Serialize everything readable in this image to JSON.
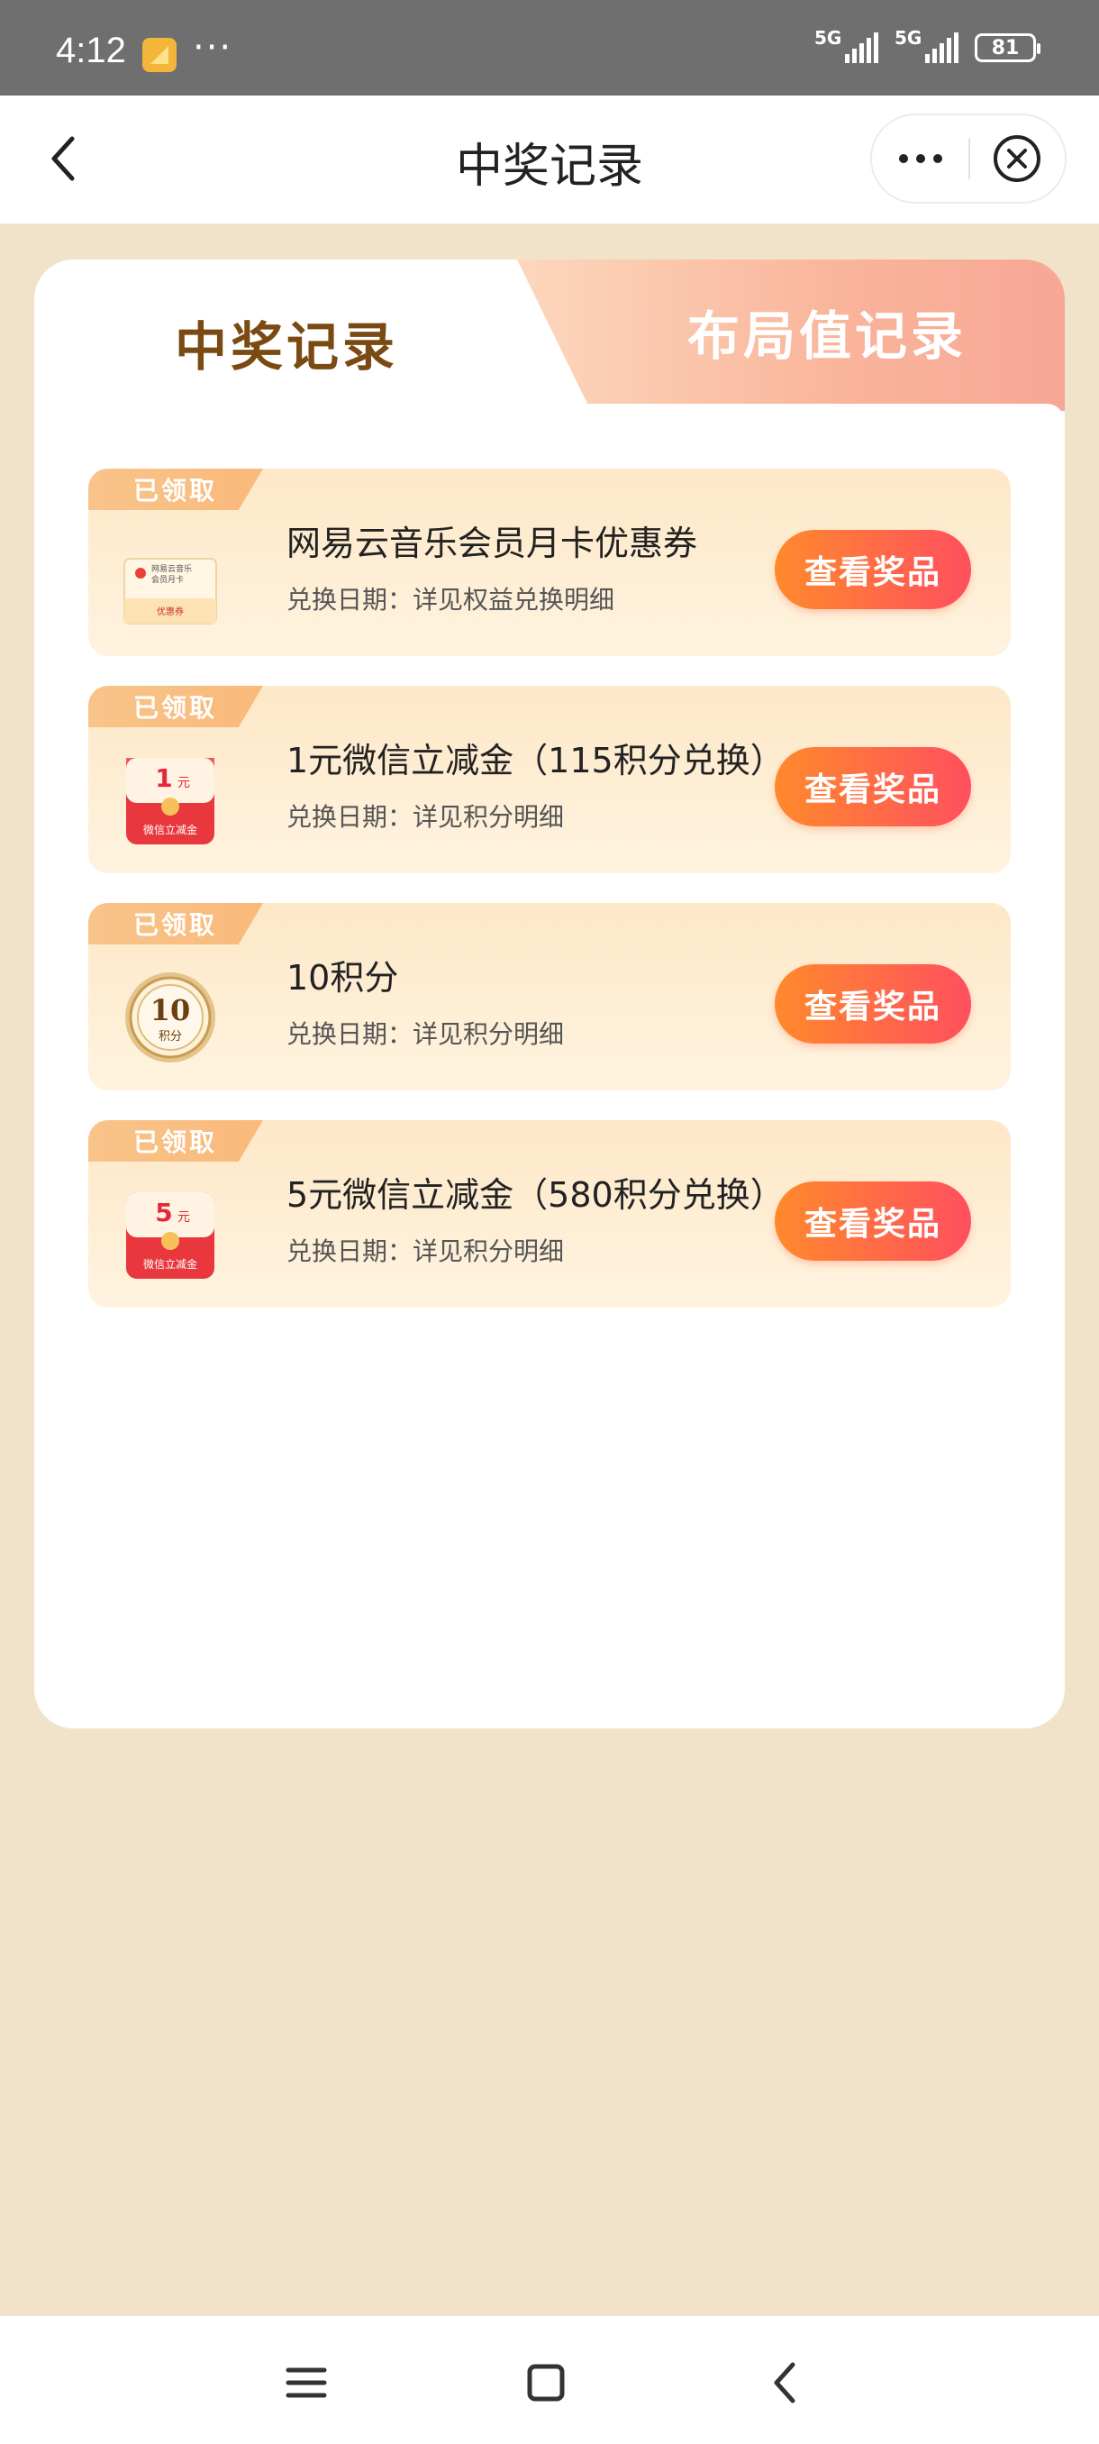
{
  "status_bar": {
    "time": "4:12",
    "dots": "···",
    "signal1_label": "5G",
    "signal2_label": "5G",
    "battery": "81"
  },
  "nav": {
    "title": "中奖记录"
  },
  "tabs": {
    "active": "中奖记录",
    "inactive": "布局值记录"
  },
  "records": [
    {
      "badge": "已领取",
      "title": "网易云音乐会员月卡优惠券",
      "subtitle": "兑换日期：详见权益兑换明细",
      "button": "查看奖品",
      "thumb": "coupon-card-icon",
      "thumb_text_top": "网易云音乐 会员月卡",
      "thumb_text_bottom": "优惠券"
    },
    {
      "badge": "已领取",
      "title": "1元微信立减金（115积分兑换）",
      "subtitle": "兑换日期：详见积分明细",
      "button": "查看奖品",
      "thumb": "red-envelope-icon",
      "thumb_amount": "1",
      "thumb_unit": "元",
      "thumb_caption": "微信立减金"
    },
    {
      "badge": "已领取",
      "title": "10积分",
      "subtitle": "兑换日期：详见积分明细",
      "button": "查看奖品",
      "thumb": "points-coin-icon",
      "thumb_amount": "10",
      "thumb_caption": "积分"
    },
    {
      "badge": "已领取",
      "title": "5元微信立减金（580积分兑换）",
      "subtitle": "兑换日期：详见积分明细",
      "button": "查看奖品",
      "thumb": "red-envelope-icon",
      "thumb_amount": "5",
      "thumb_unit": "元",
      "thumb_caption": "微信立减金"
    }
  ],
  "colors": {
    "page_bg": "#f1e3c9",
    "tab_active_text": "#7a4a12",
    "button_gradient_start": "#ff8a2c",
    "button_gradient_end": "#ff4f5e"
  }
}
